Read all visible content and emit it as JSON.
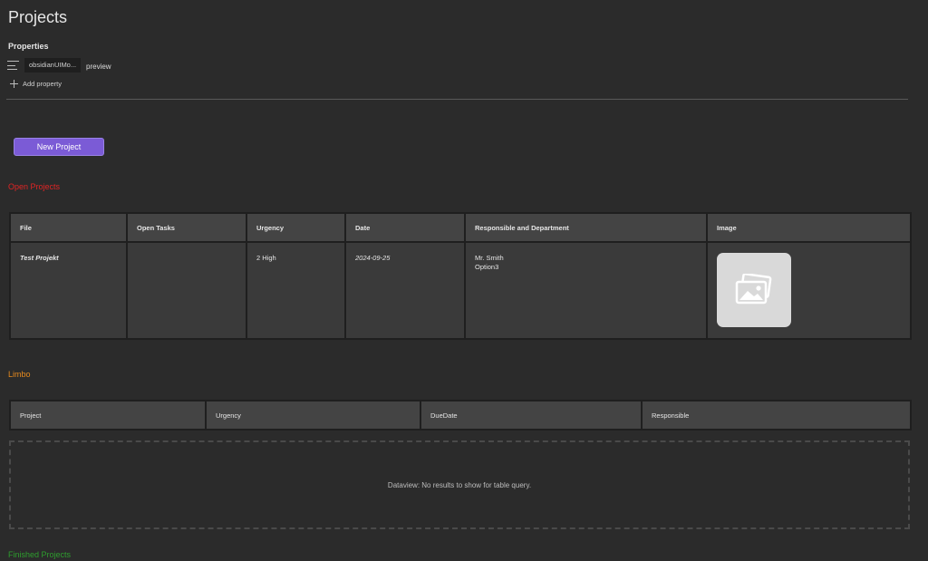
{
  "title": "Projects",
  "properties": {
    "heading": "Properties",
    "items": [
      {
        "key": "obsidianUIMo...",
        "value": "preview"
      }
    ],
    "add_label": "Add property"
  },
  "new_project_label": "New Project",
  "sections": {
    "open": {
      "title": "Open Projects",
      "columns": [
        "File",
        "Open Tasks",
        "Urgency",
        "Date",
        "Responsible and Department",
        "Image"
      ],
      "rows": [
        {
          "file": "Test Projekt",
          "open_tasks": "",
          "urgency": "2 High",
          "date": "2024-09-25",
          "responsible": "Mr. Smith",
          "department": "Option3",
          "image_icon": "image-placeholder-icon"
        }
      ]
    },
    "limbo": {
      "title": "Limbo",
      "columns": [
        "Project",
        "Urgency",
        "DueDate",
        "Responsible"
      ],
      "empty_message": "Dataview: No results to show for table query."
    },
    "finished": {
      "title": "Finished Projects"
    }
  },
  "colors": {
    "background": "#2b2b2b",
    "accent": "#7b5bd6",
    "open_heading": "#e02424",
    "limbo_heading": "#e68a1e",
    "finished_heading": "#2e9e2e",
    "urgency_high": "#f0a030"
  }
}
